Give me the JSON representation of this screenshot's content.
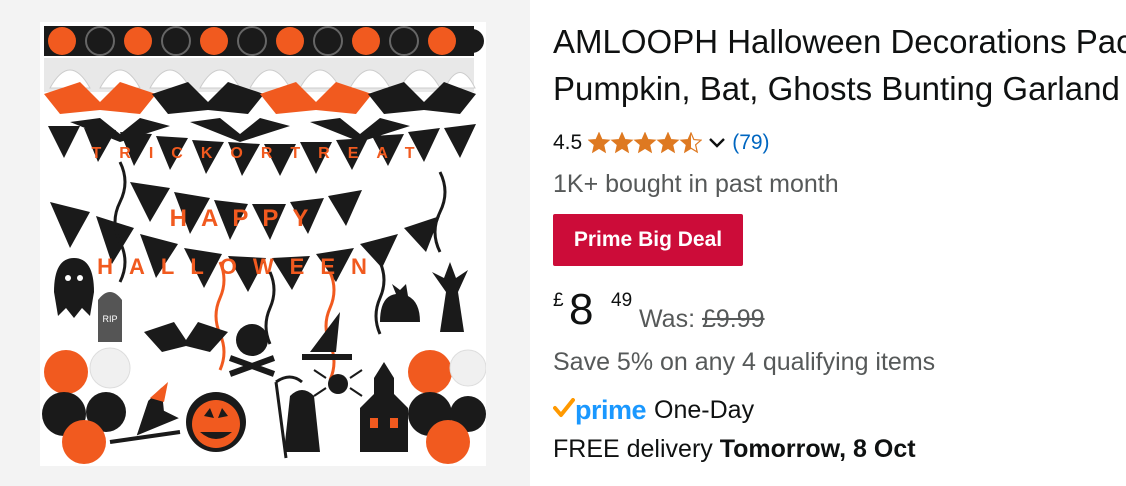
{
  "product": {
    "title_line1": "AMLOOPH Halloween Decorations Pack -",
    "title_line2": "Pumpkin, Bat, Ghosts Bunting Garland",
    "image_alt": "Halloween decorations set with trick or treat and happy halloween banners, pumpkin and bat garlands, hanging swirls and balloons",
    "image_banner_text": [
      "TRICK OR TREAT",
      "HAPPY",
      "HALLOWEEN"
    ]
  },
  "rating": {
    "value": "4.5",
    "stars": 4.5,
    "count": "(79)"
  },
  "bought": "1K+ bought in past month",
  "deal_badge": "Prime Big Deal",
  "price": {
    "currency": "£",
    "whole": "8",
    "fraction": "49",
    "was_label": "Was:",
    "was_price": "£9.99"
  },
  "save_text": "Save 5% on any 4 qualifying items",
  "prime": {
    "logo_text": "prime",
    "speed": "One-Day"
  },
  "delivery": {
    "prefix": "FREE delivery",
    "date": "Tomorrow, 8 Oct"
  },
  "colors": {
    "star": "#de7921",
    "link": "#0066c0",
    "deal_bg": "#cc0c39",
    "prime_blue": "#1a98ff",
    "prime_check": "#ff9900",
    "halloween_orange": "#f15a1f",
    "halloween_black": "#1a1a1a"
  }
}
